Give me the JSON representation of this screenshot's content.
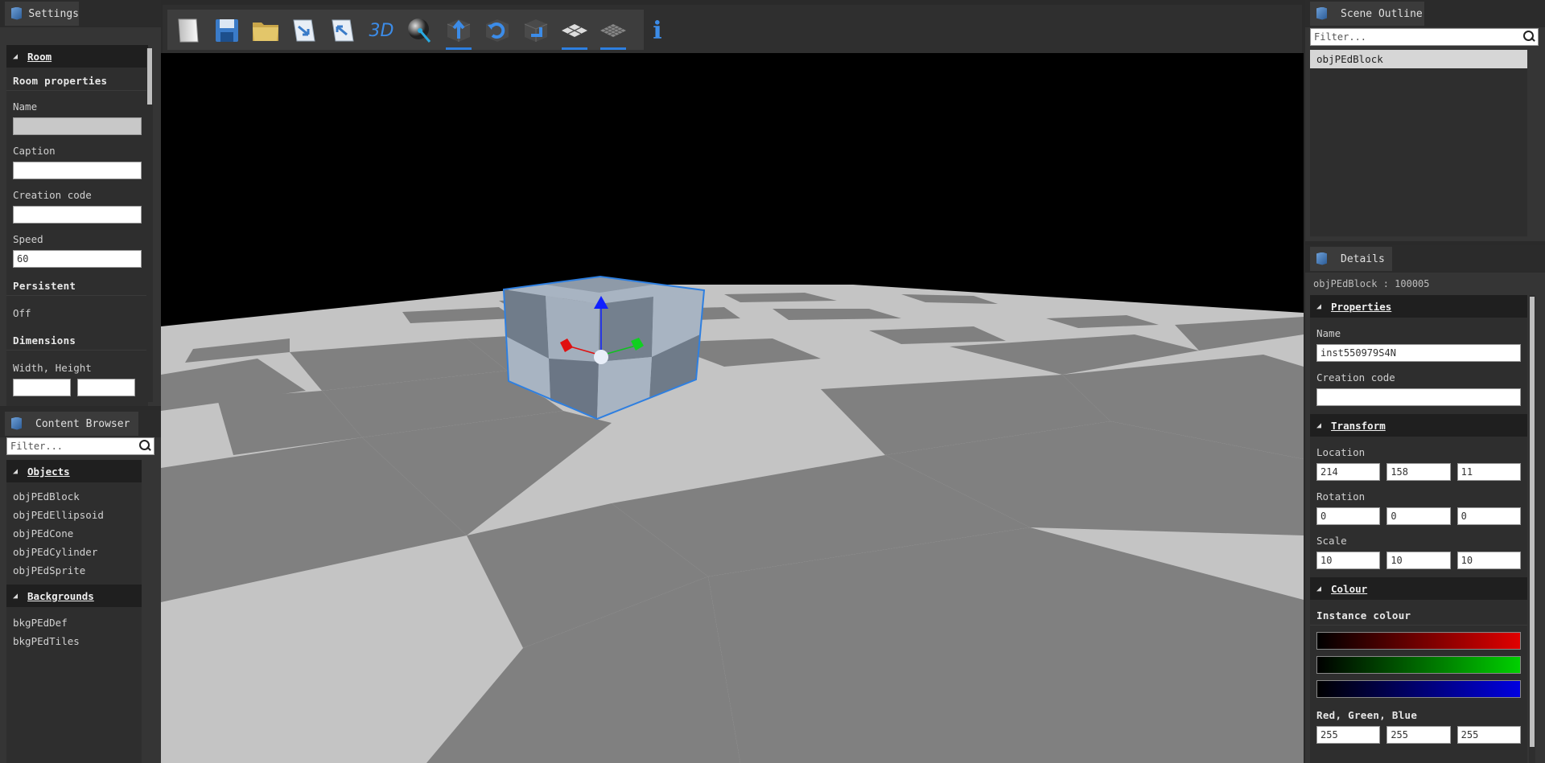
{
  "settings": {
    "tab_title": "Settings",
    "room_section": "Room",
    "room_properties": "Room properties",
    "name_label": "Name",
    "name_value": "",
    "caption_label": "Caption",
    "caption_value": "",
    "creation_code_label": "Creation code",
    "creation_code_value": "",
    "speed_label": "Speed",
    "speed_value": "60",
    "persistent_label": "Persistent",
    "persistent_value": "Off",
    "dimensions_label": "Dimensions",
    "width_height_label": "Width, Height"
  },
  "content_browser": {
    "tab_title": "Content Browser",
    "filter_placeholder": "Filter...",
    "objects_section": "Objects",
    "objects": [
      "objPEdBlock",
      "objPEdEllipsoid",
      "objPEdCone",
      "objPEdCylinder",
      "objPEdSprite"
    ],
    "backgrounds_section": "Backgrounds",
    "backgrounds": [
      "bkgPEdDef",
      "bkgPEdTiles"
    ]
  },
  "toolbar": {
    "tools": [
      "new-room",
      "save",
      "open",
      "export",
      "import",
      "3d-view",
      "material-sphere",
      "move-tool",
      "rotate-tool",
      "scale-tool",
      "grid",
      "grid-fine",
      "info"
    ],
    "active_tools": [
      "move-tool",
      "grid",
      "grid-fine"
    ],
    "label_3d": "3D",
    "label_info": "i"
  },
  "scene_outline": {
    "tab_title": "Scene Outline",
    "filter_placeholder": "Filter...",
    "items": [
      "objPEdBlock"
    ]
  },
  "details": {
    "tab_title": "Details",
    "instance_header": "objPEdBlock : 100005",
    "properties_section": "Properties",
    "name_label": "Name",
    "name_value": "inst550979S4N",
    "creation_code_label": "Creation code",
    "creation_code_value": "",
    "transform_section": "Transform",
    "location_label": "Location",
    "location": [
      "214",
      "158",
      "11"
    ],
    "rotation_label": "Rotation",
    "rotation": [
      "0",
      "0",
      "0"
    ],
    "scale_label": "Scale",
    "scale": [
      "10",
      "10",
      "10"
    ],
    "colour_section": "Colour",
    "instance_colour_label": "Instance colour",
    "rgb_label": "Red, Green, Blue",
    "rgb": [
      "255",
      "255",
      "255"
    ]
  },
  "colors": {
    "accent": "#2e7fe0",
    "panel_bg": "#353535",
    "floor_light": "#c4c4c4",
    "floor_dark": "#808080"
  }
}
